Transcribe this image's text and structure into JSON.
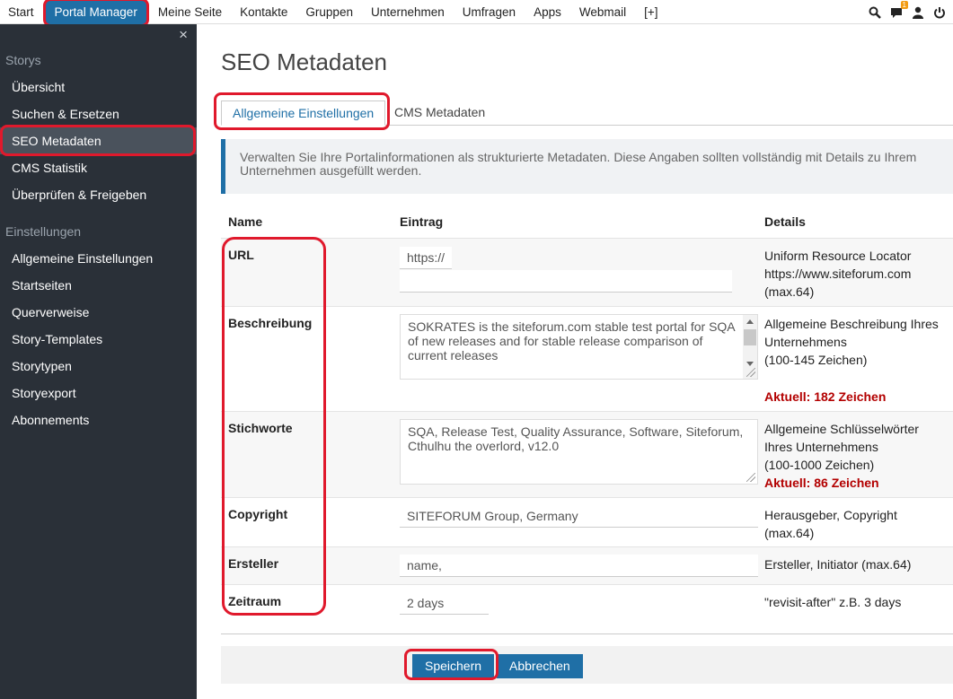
{
  "topnav": {
    "items": [
      "Start",
      "Portal Manager",
      "Meine Seite",
      "Kontakte",
      "Gruppen",
      "Unternehmen",
      "Umfragen",
      "Apps",
      "Webmail",
      "[+]"
    ],
    "active_index": 1,
    "icons": [
      "search-icon",
      "chat-icon",
      "user-icon",
      "power-icon"
    ],
    "notification_count": "1"
  },
  "sidebar": {
    "close_glyph": "×",
    "section1": "Storys",
    "items1": [
      "Übersicht",
      "Suchen & Ersetzen",
      "SEO Metadaten",
      "CMS Statistik",
      "Überprüfen & Freigeben"
    ],
    "section2": "Einstellungen",
    "items2": [
      "Allgemeine Einstellungen",
      "Startseiten",
      "Querverweise",
      "Story-Templates",
      "Storytypen",
      "Storyexport",
      "Abonnements"
    ],
    "active_item": "SEO Metadaten"
  },
  "page": {
    "title": "SEO Metadaten",
    "tabs": [
      "Allgemeine Einstellungen",
      "CMS Metadaten"
    ],
    "active_tab": 0,
    "info": "Verwalten Sie Ihre Portalinformationen als strukturierte Metadaten. Diese Angaben sollten vollständig mit Details zu Ihrem Unternehmen ausgefüllt werden."
  },
  "table": {
    "headers": [
      "Name",
      "Eintrag",
      "Details"
    ],
    "rows": {
      "url": {
        "name": "URL",
        "prefix": "https://",
        "value": "",
        "details": [
          "Uniform Resource Locator",
          "https://www.siteforum.com",
          "(max.64)"
        ]
      },
      "beschreibung": {
        "name": "Beschreibung",
        "value": "SOKRATES is the siteforum.com stable test portal for SQA of new releases and for stable release comparison of current releases",
        "details": [
          "Allgemeine Beschreibung Ihres",
          "Unternehmens",
          "(100-145 Zeichen)"
        ],
        "warning": "Aktuell: 182 Zeichen"
      },
      "stichworte": {
        "name": "Stichworte",
        "value": "SQA, Release Test, Quality Assurance, Software, Siteforum, Cthulhu the overlord, v12.0",
        "details": [
          "Allgemeine Schlüsselwörter",
          "Ihres Unternehmens",
          "(100-1000 Zeichen)"
        ],
        "warning": "Aktuell: 86 Zeichen"
      },
      "copyright": {
        "name": "Copyright",
        "value": "SITEFORUM Group, Germany",
        "details": [
          "Herausgeber, Copyright",
          "(max.64)"
        ]
      },
      "ersteller": {
        "name": "Ersteller",
        "value": "name,",
        "details": [
          "Ersteller, Initiator (max.64)"
        ]
      },
      "zeitraum": {
        "name": "Zeitraum",
        "value": "2 days",
        "details": [
          "\"revisit-after\" z.B. 3 days"
        ]
      }
    }
  },
  "buttons": {
    "save": "Speichern",
    "cancel": "Abbrechen"
  },
  "colors": {
    "accent": "#1f6fa6",
    "sidebar_bg": "#2a3038",
    "highlight_ring": "#e0192c",
    "warning": "#b30000"
  }
}
